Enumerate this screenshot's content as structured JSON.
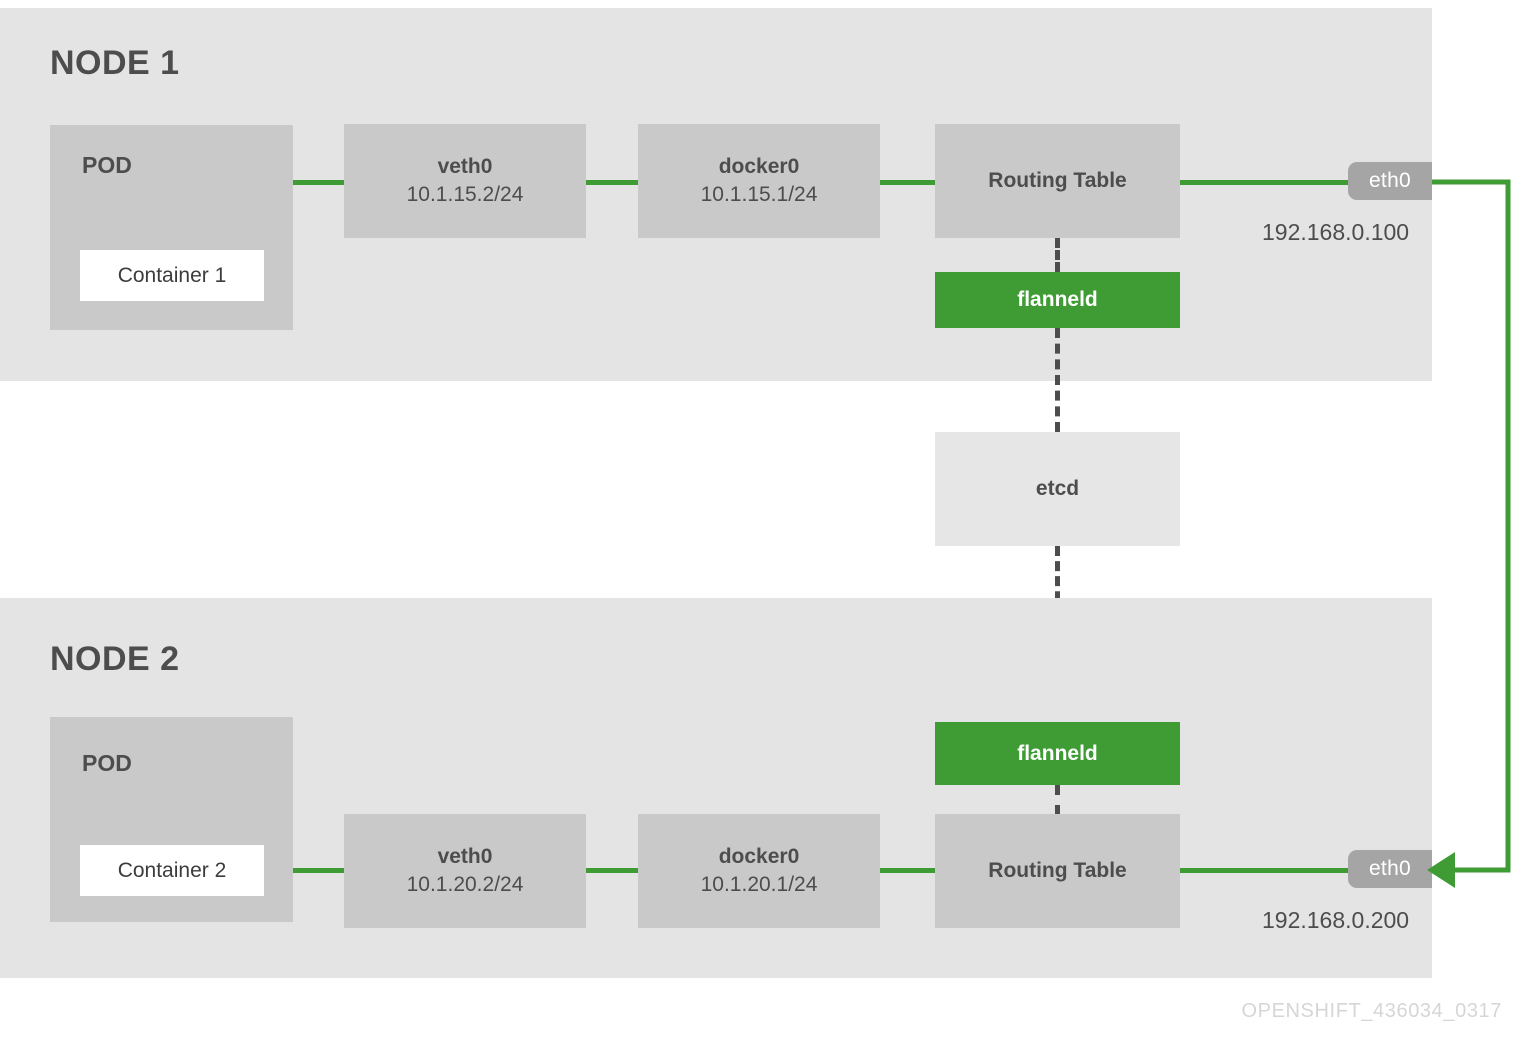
{
  "diagram": {
    "caption": "OPENSHIFT_436034_0317",
    "colors": {
      "panel_bg": "#e4e4e4",
      "box_gray": "#c9c9c9",
      "etcd_gray": "#e6e6e6",
      "flannel_green": "#3f9c35",
      "link_green": "#3f9c35",
      "badge_gray": "#a5a5a5",
      "text_gray": "#4d4d4d",
      "container_white": "#ffffff",
      "caption_gray": "#d6d6d6"
    }
  },
  "node1": {
    "title": "NODE 1",
    "pod": {
      "label": "POD",
      "container": "Container 1"
    },
    "veth": {
      "name": "veth0",
      "cidr": "10.1.15.2/24"
    },
    "docker": {
      "name": "docker0",
      "cidr": "10.1.15.1/24"
    },
    "routing_table": "Routing Table",
    "flanneld": "flanneld",
    "eth": {
      "name": "eth0",
      "ip": "192.168.0.100"
    }
  },
  "node2": {
    "title": "NODE 2",
    "pod": {
      "label": "POD",
      "container": "Container 2"
    },
    "veth": {
      "name": "veth0",
      "cidr": "10.1.20.2/24"
    },
    "docker": {
      "name": "docker0",
      "cidr": "10.1.20.1/24"
    },
    "routing_table": "Routing Table",
    "flanneld": "flanneld",
    "eth": {
      "name": "eth0",
      "ip": "192.168.0.200"
    }
  },
  "shared": {
    "etcd": "etcd"
  }
}
